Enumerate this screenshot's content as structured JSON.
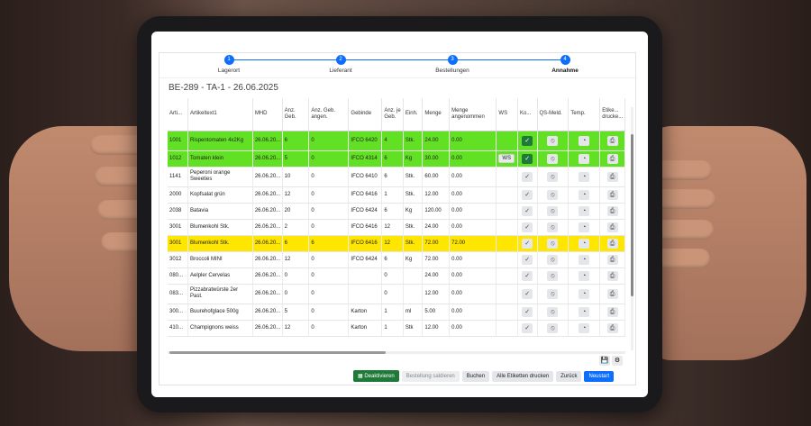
{
  "stepper": [
    {
      "num": "1",
      "label": "Lagerort"
    },
    {
      "num": "2",
      "label": "Lieferant"
    },
    {
      "num": "3",
      "label": "Bestellungen"
    },
    {
      "num": "4",
      "label": "Annahme"
    }
  ],
  "order_title": "BE-289 - TA-1 - 26.06.2025",
  "columns": [
    "Arti...",
    "Artikeltext1",
    "MHD",
    "Anz. Geb.",
    "Anz. Geb. angen.",
    "Gebinde",
    "Anz. je Geb.",
    "Einh.",
    "Menge",
    "Menge angenommen",
    "WS",
    "Ko...",
    "QS-Meld.",
    "Temp.",
    "Etike... drucke..."
  ],
  "rows": [
    {
      "nr": "1001",
      "text": "Rispentomaten 4x2Kg",
      "mhd": "26.06.20...",
      "anz": "6",
      "angen": "0",
      "gebinde": "IFCO 6420",
      "je": "4",
      "einh": "Stk.",
      "menge": "24.00",
      "menge_ang": "0.00",
      "ws": "",
      "status": "green",
      "checked": true
    },
    {
      "nr": "1012",
      "text": "Tomaten klein",
      "mhd": "26.06.20...",
      "anz": "5",
      "angen": "0",
      "gebinde": "IFCO 4314",
      "je": "6",
      "einh": "Kg",
      "menge": "30.00",
      "menge_ang": "0.00",
      "ws": "WS",
      "status": "green",
      "checked": true
    },
    {
      "nr": "1141",
      "text": "Peperoni orange Sweeties",
      "mhd": "26.06.20...",
      "anz": "10",
      "angen": "0",
      "gebinde": "IFCO 6410",
      "je": "6",
      "einh": "Stk.",
      "menge": "60.00",
      "menge_ang": "0.00",
      "ws": "",
      "status": "",
      "checked": false
    },
    {
      "nr": "2000",
      "text": "Kopfsalat grün",
      "mhd": "26.06.20...",
      "anz": "12",
      "angen": "0",
      "gebinde": "IFCO 6416",
      "je": "1",
      "einh": "Stk.",
      "menge": "12.00",
      "menge_ang": "0.00",
      "ws": "",
      "status": "",
      "checked": false
    },
    {
      "nr": "2038",
      "text": "Batavia",
      "mhd": "26.06.20...",
      "anz": "20",
      "angen": "0",
      "gebinde": "IFCO 6424",
      "je": "6",
      "einh": "Kg",
      "menge": "120.00",
      "menge_ang": "0.00",
      "ws": "",
      "status": "",
      "checked": false
    },
    {
      "nr": "3001",
      "text": "Blumenkohl Stk.",
      "mhd": "26.06.20...",
      "anz": "2",
      "angen": "0",
      "gebinde": "IFCO 6416",
      "je": "12",
      "einh": "Stk.",
      "menge": "24.00",
      "menge_ang": "0.00",
      "ws": "",
      "status": "",
      "checked": false
    },
    {
      "nr": "3001",
      "text": "Blumenkohl Stk.",
      "mhd": "26.06.20...",
      "anz": "6",
      "angen": "6",
      "gebinde": "IFCO 6416",
      "je": "12",
      "einh": "Stk.",
      "menge": "72.00",
      "menge_ang": "72.00",
      "ws": "",
      "status": "yellow",
      "checked": false
    },
    {
      "nr": "3012",
      "text": "Broccoli MINI",
      "mhd": "26.06.20...",
      "anz": "12",
      "angen": "0",
      "gebinde": "IFCO 6424",
      "je": "6",
      "einh": "Kg",
      "menge": "72.00",
      "menge_ang": "0.00",
      "ws": "",
      "status": "",
      "checked": false
    },
    {
      "nr": "080...",
      "text": "Aelpler Cervelas",
      "mhd": "26.06.20...",
      "anz": "0",
      "angen": "0",
      "gebinde": "",
      "je": "0",
      "einh": "",
      "menge": "24.00",
      "menge_ang": "0.00",
      "ws": "",
      "status": "",
      "checked": false
    },
    {
      "nr": "083...",
      "text": "Pizzabratwürste 2er Past.",
      "mhd": "26.06.20...",
      "anz": "0",
      "angen": "0",
      "gebinde": "",
      "je": "0",
      "einh": "",
      "menge": "12.00",
      "menge_ang": "0.00",
      "ws": "",
      "status": "",
      "checked": false
    },
    {
      "nr": "300...",
      "text": "Buurehofglace 500g",
      "mhd": "26.06.20...",
      "anz": "5",
      "angen": "0",
      "gebinde": "Karton",
      "je": "1",
      "einh": "ml",
      "menge": "5.00",
      "menge_ang": "0.00",
      "ws": "",
      "status": "",
      "checked": false
    },
    {
      "nr": "410...",
      "text": "Champignons weiss",
      "mhd": "26.06.20...",
      "anz": "12",
      "angen": "0",
      "gebinde": "Karton",
      "je": "1",
      "einh": "Stk",
      "menge": "12.00",
      "menge_ang": "0.00",
      "ws": "",
      "status": "",
      "checked": false
    }
  ],
  "actions": {
    "deactivate": "Deaktivieren",
    "settle": "Bestellung saldieren",
    "book": "Buchen",
    "print_all": "Alle Etiketten drucken",
    "back": "Zurück",
    "restart": "Neustart"
  },
  "colors": {
    "accent": "#0d6efd",
    "ok_row": "#62e024",
    "partial_row": "#ffe600",
    "success_button": "#1f7a3a"
  }
}
